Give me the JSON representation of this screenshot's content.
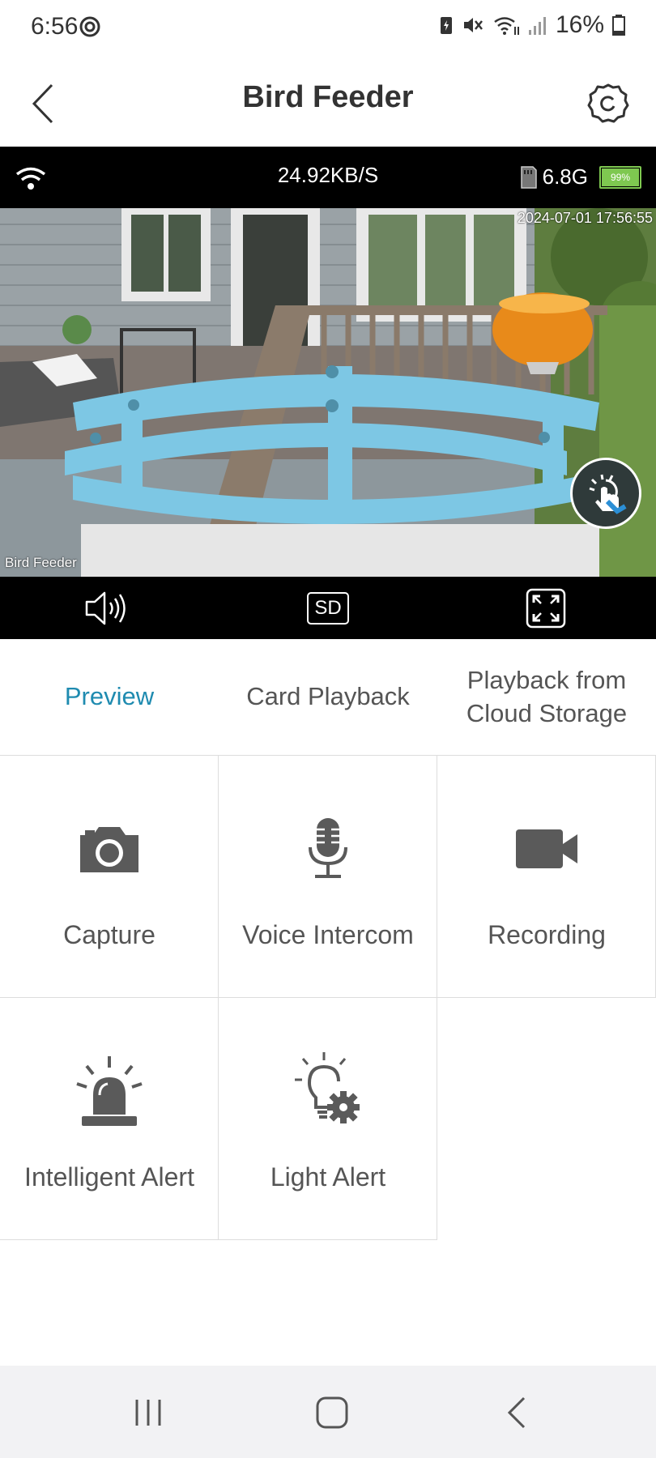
{
  "status_bar": {
    "time": "6:56",
    "battery": "16%"
  },
  "header": {
    "title": "Bird Feeder"
  },
  "video": {
    "speed": "24.92KB/S",
    "storage": "6.8G",
    "camera_battery": "99%",
    "timestamp": "2024-07-01 17:56:55",
    "overlay_label": "Bird Feeder",
    "quality": "SD"
  },
  "tabs": [
    {
      "label": "Preview",
      "active": true
    },
    {
      "label": "Card Playback",
      "active": false
    },
    {
      "label": "Playback from Cloud Storage",
      "active": false
    }
  ],
  "actions": [
    {
      "label": "Capture",
      "icon": "camera-icon"
    },
    {
      "label": "Voice Intercom",
      "icon": "microphone-icon"
    },
    {
      "label": "Recording",
      "icon": "video-camera-icon"
    },
    {
      "label": "Intelligent Alert",
      "icon": "siren-icon"
    },
    {
      "label": "Light Alert",
      "icon": "lightbulb-gear-icon"
    }
  ],
  "colors": {
    "accent": "#1f8bb0",
    "icon_gray": "#5a5a5a",
    "battery_green": "#7ec850"
  }
}
